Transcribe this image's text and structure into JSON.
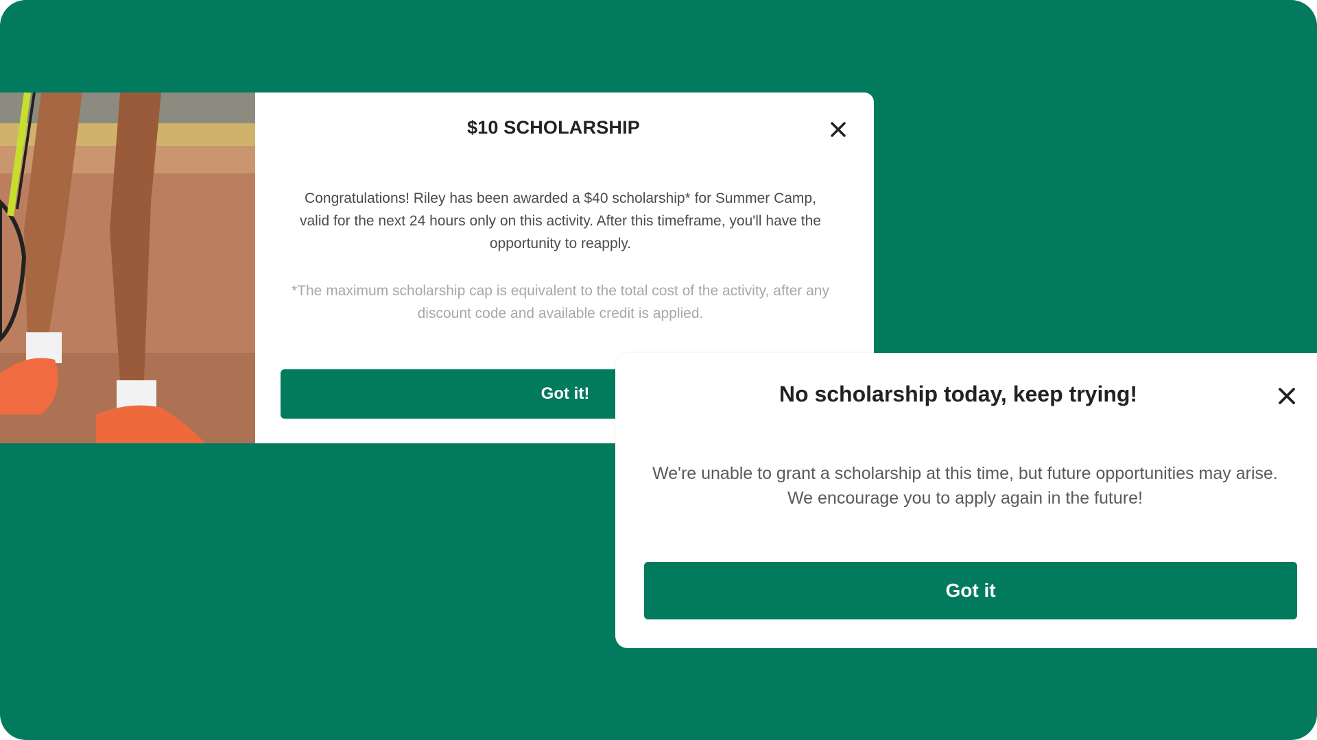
{
  "colors": {
    "background": "#017a5e",
    "button": "#017a5e",
    "card": "#ffffff",
    "title_text": "#222222",
    "body_text": "#4b4b4b",
    "note_text": "#a7a7a7"
  },
  "modal_scholarship": {
    "image": "tennis-player-feet-photo",
    "title": "$10 SCHOLARSHIP",
    "close_icon": "close-icon",
    "message": "Congratulations! Riley has been awarded a $40 scholarship* for Summer Camp, valid for the next 24 hours only on this activity. After this timeframe, you'll have the opportunity to reapply.",
    "note": "*The maximum scholarship cap is equivalent to the total cost of the activity, after any discount code and available credit is applied.",
    "button_label": "Got it!"
  },
  "modal_no_scholarship": {
    "title": "No scholarship today, keep trying!",
    "close_icon": "close-icon",
    "message": "We're unable to grant a scholarship at this time, but future opportunities may arise. We encourage you to apply again in the future!",
    "button_label": "Got it"
  }
}
